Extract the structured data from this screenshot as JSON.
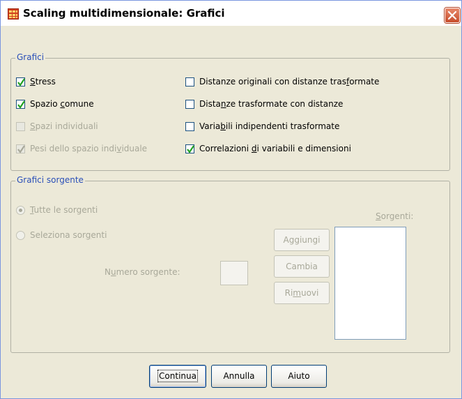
{
  "window": {
    "title": "Scaling multidimensionale: Grafici"
  },
  "grafici": {
    "legend": "Grafici",
    "left": [
      {
        "label": "Stress",
        "checked": true,
        "enabled": true
      },
      {
        "label": "Spazio comune",
        "checked": true,
        "enabled": true
      },
      {
        "label": "Spazi individuali",
        "checked": false,
        "enabled": false
      },
      {
        "label": "Pesi dello spazio individuale",
        "checked": true,
        "enabled": false
      }
    ],
    "right": [
      {
        "label": "Distanze originali con distanze trasformate",
        "checked": false,
        "enabled": true
      },
      {
        "label": "Distanze trasformate con distanze",
        "checked": false,
        "enabled": true
      },
      {
        "label": "Variabili indipendenti trasformate",
        "checked": false,
        "enabled": true
      },
      {
        "label": "Correlazioni di variabili e dimensioni",
        "checked": true,
        "enabled": true
      }
    ]
  },
  "grafici_sorgente": {
    "legend": "Grafici sorgente",
    "radio_all": "Tutte le sorgenti",
    "radio_select": "Seleziona sorgenti",
    "selected_radio": "Tutte le sorgenti",
    "numero_label": "Numero sorgente:",
    "numero_value": "",
    "sorgenti_label": "Sorgenti:",
    "add_label": "Aggiungi",
    "change_label": "Cambia",
    "remove_label": "Rimuovi"
  },
  "footer": {
    "continue_label": "Continua",
    "cancel_label": "Annulla",
    "help_label": "Aiuto"
  },
  "colors": {
    "group_title": "#2a4fb8",
    "check_mark": "#21a121",
    "disabled_text": "#a8a899"
  }
}
